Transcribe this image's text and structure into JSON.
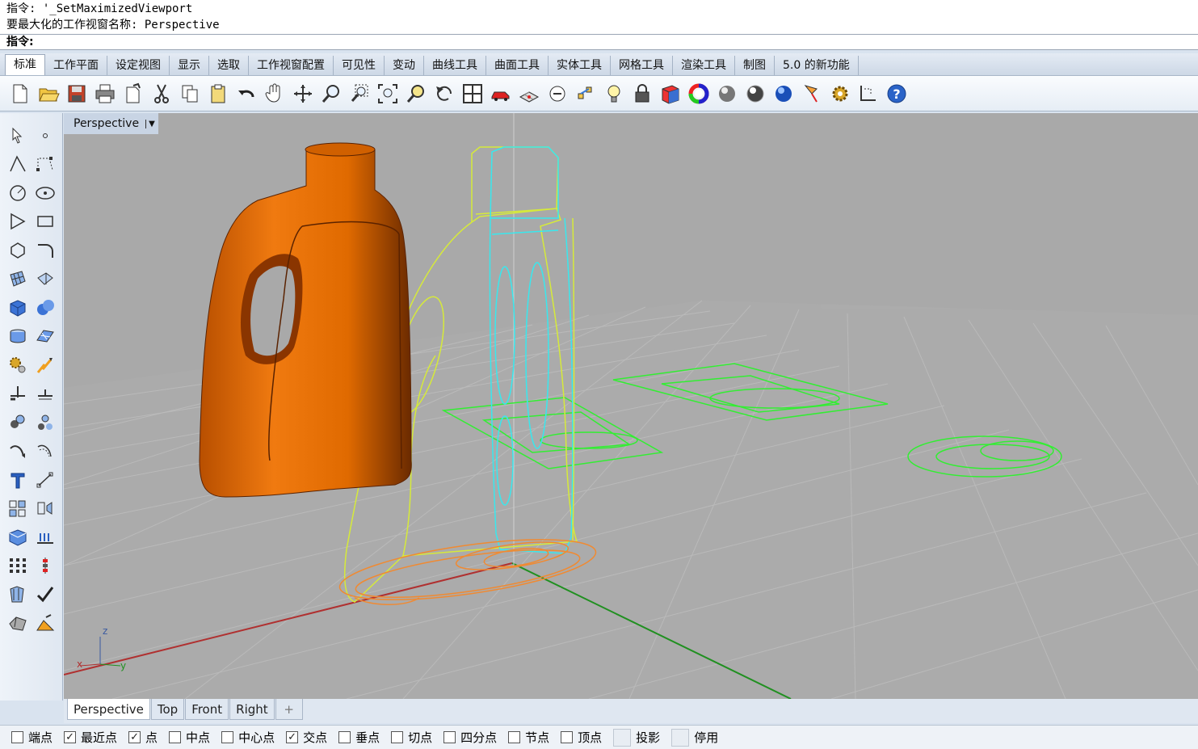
{
  "command": {
    "history": [
      "指令: '_SetMaximizedViewport",
      "要最大化的工作视窗名称: Perspective"
    ],
    "prompt_label": "指令:",
    "input_value": ""
  },
  "tabs": [
    {
      "label": "标准",
      "active": true
    },
    {
      "label": "工作平面"
    },
    {
      "label": "设定视图"
    },
    {
      "label": "显示"
    },
    {
      "label": "选取"
    },
    {
      "label": "工作视窗配置"
    },
    {
      "label": "可见性"
    },
    {
      "label": "变动"
    },
    {
      "label": "曲线工具"
    },
    {
      "label": "曲面工具"
    },
    {
      "label": "实体工具"
    },
    {
      "label": "网格工具"
    },
    {
      "label": "渲染工具"
    },
    {
      "label": "制图"
    },
    {
      "label": "5.0 的新功能"
    }
  ],
  "viewport": {
    "label": "Perspective",
    "axis_labels": {
      "z": "z",
      "x": "x",
      "y": "y"
    }
  },
  "viewport_tabs": [
    "Perspective",
    "Top",
    "Front",
    "Right",
    "+"
  ],
  "osnap": [
    {
      "label": "端点",
      "checked": false
    },
    {
      "label": "最近点",
      "checked": true
    },
    {
      "label": "点",
      "checked": true
    },
    {
      "label": "中点",
      "checked": false
    },
    {
      "label": "中心点",
      "checked": false
    },
    {
      "label": "交点",
      "checked": true
    },
    {
      "label": "垂点",
      "checked": false
    },
    {
      "label": "切点",
      "checked": false
    },
    {
      "label": "四分点",
      "checked": false
    },
    {
      "label": "节点",
      "checked": false
    },
    {
      "label": "顶点",
      "checked": false
    },
    {
      "label": "投影",
      "checked": false,
      "style": "flat"
    },
    {
      "label": "停用",
      "checked": false,
      "style": "flat"
    }
  ],
  "colors": {
    "viewport_bg": "#a8a8a8",
    "grid": "#b8b8b8",
    "bottle": "#e06a00",
    "curve_yellow": "#d6ea3a",
    "curve_cyan": "#38e8ee",
    "curve_green": "#32ee32",
    "curve_orange": "#f08a32",
    "axis_x": "#b03030",
    "axis_y": "#209020"
  }
}
